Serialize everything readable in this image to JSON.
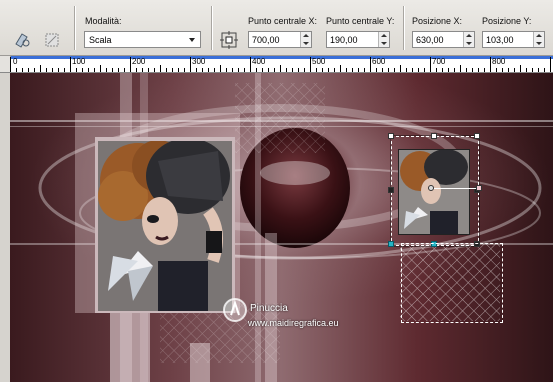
{
  "toolbar": {
    "mode_label": "Modalità:",
    "mode_value": "Scala",
    "center_x_label": "Punto centrale X:",
    "center_x_value": "700,00",
    "center_y_label": "Punto centrale Y:",
    "center_y_value": "190,00",
    "pos_x_label": "Posizione X:",
    "pos_x_value": "630,00",
    "pos_y_label": "Posizione Y:",
    "pos_y_value": "103,00"
  },
  "ruler": {
    "marks": [
      "0",
      "100",
      "200",
      "300",
      "400",
      "500",
      "600",
      "700",
      "800"
    ]
  },
  "canvas": {
    "watermark_line1": "Pinuccia",
    "watermark_line2": "www.maidiregrafica.eu"
  },
  "icons": {
    "tool_a": "pick-tool-icon",
    "tool_b": "free-transform-icon",
    "tool_c": "center-point-icon"
  }
}
